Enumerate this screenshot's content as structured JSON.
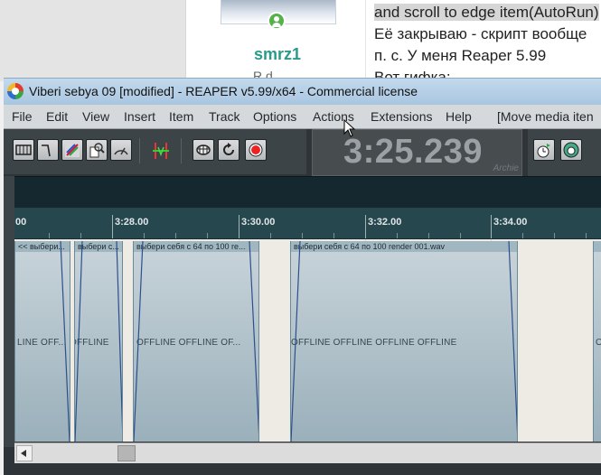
{
  "web": {
    "username": "smrz1",
    "rank_partial": "R     d",
    "text_lines": [
      "and scroll to edge item(AutoRun)",
      "Её закрываю - скрипт вообще",
      "п. с. У меня Reaper 5.99",
      "Вот гифка:"
    ]
  },
  "window": {
    "title": "Viberi sebya 09 [modified] - REAPER v5.99/x64 - Commercial license"
  },
  "menu": {
    "items": [
      "File",
      "Edit",
      "View",
      "Insert",
      "Item",
      "Track",
      "Options",
      "Actions",
      "Extensions",
      "Help",
      "[Move media iten"
    ]
  },
  "transport": {
    "time": "3:25.239",
    "theme_label": "Archie"
  },
  "ruler": {
    "labels": [
      "00",
      "3:28.00",
      "3:30.00",
      "3:32.00",
      "3:34.00"
    ]
  },
  "items": [
    {
      "name": "<< выбери...",
      "offline": "LINE     OFF..."
    },
    {
      "name": "выбери с...",
      "offline": "OFFLINE"
    },
    {
      "name": "выбери себя с 64 по 100 re...",
      "offline": "OFFLINE     OFFLINE     OF..."
    },
    {
      "name": "выбери себя с 64 по 100 render 001.wav",
      "offline": "OFFLINE     OFFLINE     OFFLINE     OFFLINE"
    },
    {
      "name": "",
      "offline": "OF"
    }
  ],
  "icons": [
    "track-icon",
    "envelope-icon",
    "color-icon",
    "item-props-icon",
    "meter-icon",
    "ripple-icon",
    "metronome-icon",
    "loop-icon",
    "record-icon",
    "clock-icon",
    "headphone-icon"
  ],
  "colors": {
    "accent_item": "#9ab0bb",
    "ruler_bg": "#27474f",
    "titlebar": "#b3cde4"
  }
}
